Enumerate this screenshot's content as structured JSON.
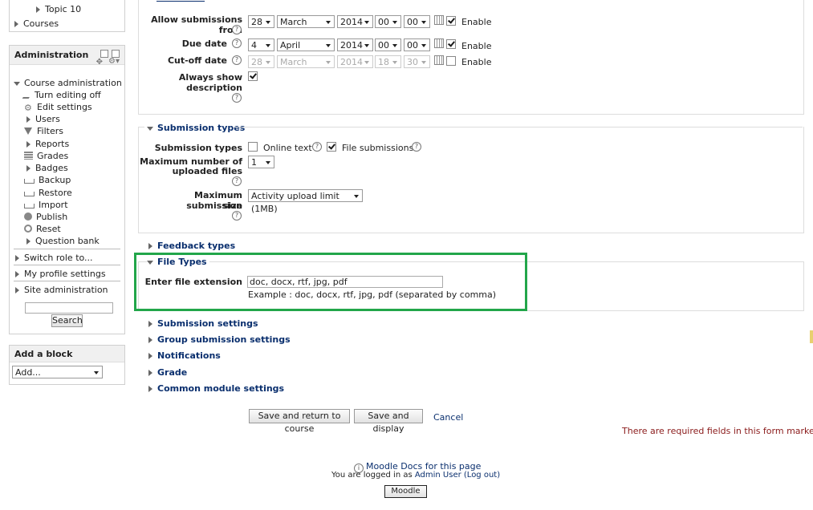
{
  "sidebar": {
    "top_items": [
      {
        "label": "Topic 10"
      },
      {
        "label": "Courses"
      }
    ],
    "administration": {
      "title": "Administration",
      "course_admin_label": "Course administration",
      "items": [
        {
          "label": "Turn editing off",
          "icon": "pencil-icon"
        },
        {
          "label": "Edit settings",
          "icon": "gear-icon"
        },
        {
          "label": "Users",
          "icon": "expand-arrow-icon"
        },
        {
          "label": "Filters",
          "icon": "filter-icon"
        },
        {
          "label": "Reports",
          "icon": "expand-arrow-icon"
        },
        {
          "label": "Grades",
          "icon": "grades-icon"
        },
        {
          "label": "Badges",
          "icon": "expand-arrow-icon"
        },
        {
          "label": "Backup",
          "icon": "backup-icon"
        },
        {
          "label": "Restore",
          "icon": "restore-icon"
        },
        {
          "label": "Import",
          "icon": "import-icon"
        },
        {
          "label": "Publish",
          "icon": "globe-icon"
        },
        {
          "label": "Reset",
          "icon": "reset-icon"
        },
        {
          "label": "Question bank",
          "icon": "expand-arrow-icon"
        }
      ],
      "switch_role": "Switch role to...",
      "profile_settings": "My profile settings",
      "site_admin": "Site administration",
      "search_button": "Search"
    },
    "add_block": {
      "title": "Add a block",
      "select_value": "Add..."
    }
  },
  "availability": {
    "allow_label": "Allow submissions from",
    "allow": {
      "day": "28",
      "month": "March",
      "year": "2014",
      "hour": "00",
      "minute": "00",
      "enable": "Enable"
    },
    "due_label": "Due date",
    "due": {
      "day": "4",
      "month": "April",
      "year": "2014",
      "hour": "00",
      "minute": "00",
      "enable": "Enable"
    },
    "cutoff_label": "Cut-off date",
    "cutoff": {
      "day": "28",
      "month": "March",
      "year": "2014",
      "hour": "18",
      "minute": "30",
      "enable": "Enable"
    },
    "always_show_label_1": "Always show",
    "always_show_label_2": "description"
  },
  "submission_types": {
    "title": "Submission types",
    "types_label": "Submission types",
    "online_text": "Online text",
    "file_submissions": "File submissions",
    "max_files_label_1": "Maximum number of",
    "max_files_label_2": "uploaded files",
    "max_files_value": "1",
    "max_size_label_1": "Maximum submission",
    "max_size_label_2": "size",
    "max_size_value": "Activity upload limit (1MB)"
  },
  "feedback_types": {
    "title": "Feedback types"
  },
  "file_types": {
    "title": "File Types",
    "ext_label": "Enter file extension",
    "ext_value": "doc, docx, rtf, jpg, pdf",
    "example": "Example : doc, docx, rtf, jpg, pdf (separated by comma)",
    "highlight_color": "#22a64a"
  },
  "collapsed_sections": [
    {
      "title": "Submission settings"
    },
    {
      "title": "Group submission settings"
    },
    {
      "title": "Notifications"
    },
    {
      "title": "Grade"
    },
    {
      "title": "Common module settings"
    }
  ],
  "buttons": {
    "save_return": "Save and return to course",
    "save_display": "Save and display",
    "cancel": "Cancel"
  },
  "required_note": "There are required fields in this form marked",
  "required_star": "*",
  "footer": {
    "docs_link": "Moodle Docs for this page",
    "logged_in_prefix": "You are logged in as",
    "user": "Admin User",
    "logout": "(Log out)",
    "home_button": "Moodle"
  }
}
